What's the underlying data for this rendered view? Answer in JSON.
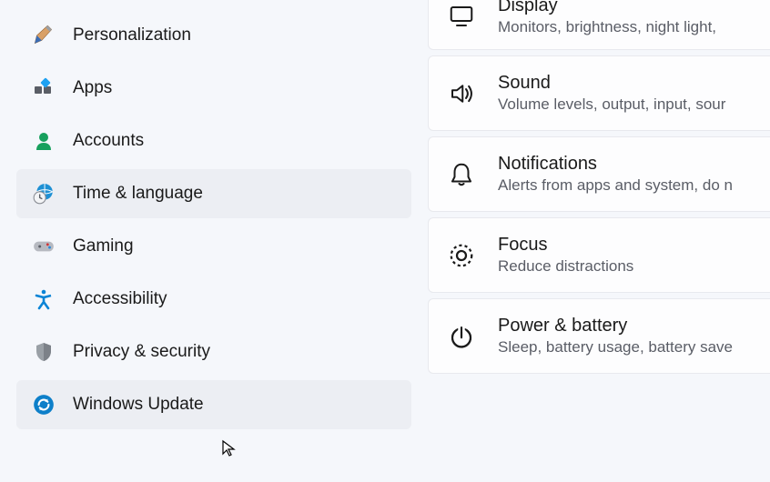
{
  "sidebar": {
    "items": [
      {
        "id": "personalization",
        "label": "Personalization",
        "icon": "paintbrush-icon"
      },
      {
        "id": "apps",
        "label": "Apps",
        "icon": "apps-icon"
      },
      {
        "id": "accounts",
        "label": "Accounts",
        "icon": "person-icon"
      },
      {
        "id": "time-language",
        "label": "Time & language",
        "icon": "globe-clock-icon",
        "selected": true
      },
      {
        "id": "gaming",
        "label": "Gaming",
        "icon": "gamepad-icon"
      },
      {
        "id": "accessibility",
        "label": "Accessibility",
        "icon": "accessibility-icon"
      },
      {
        "id": "privacy-security",
        "label": "Privacy & security",
        "icon": "shield-icon"
      },
      {
        "id": "windows-update",
        "label": "Windows Update",
        "icon": "update-icon",
        "hover": true
      }
    ]
  },
  "cards": [
    {
      "id": "display",
      "title": "Display",
      "subtitle": "Monitors, brightness, night light,",
      "icon": "monitor-icon"
    },
    {
      "id": "sound",
      "title": "Sound",
      "subtitle": "Volume levels, output, input, sour",
      "icon": "speaker-icon"
    },
    {
      "id": "notifications",
      "title": "Notifications",
      "subtitle": "Alerts from apps and system, do n",
      "icon": "bell-icon"
    },
    {
      "id": "focus",
      "title": "Focus",
      "subtitle": "Reduce distractions",
      "icon": "focus-icon"
    },
    {
      "id": "power-battery",
      "title": "Power & battery",
      "subtitle": "Sleep, battery usage, battery save",
      "icon": "power-icon"
    }
  ]
}
